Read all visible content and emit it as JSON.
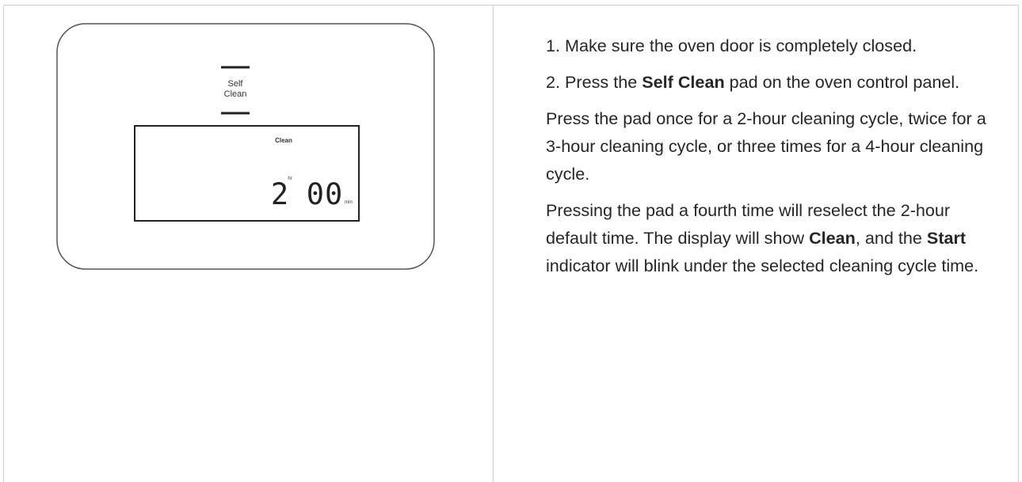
{
  "figure": {
    "pad_label_line1": "Self",
    "pad_label_line2": "Clean",
    "display_mode": "Clean",
    "hours_digit": "2",
    "hours_unit": "hr",
    "minutes_digits": "00",
    "minutes_unit": "min"
  },
  "steps": {
    "step1": "1. Make sure the oven door is completely closed.",
    "step2_prefix": "2. Press the ",
    "step2_bold": "Self Clean",
    "step2_suffix": " pad on the oven control panel.",
    "para3": "Press the pad once for a 2-hour cleaning cycle, twice for a 3-hour cleaning cycle, or three times for a 4-hour cleaning cycle.",
    "para4_prefix": "Pressing the pad a fourth time will reselect the 2-hour default time. The display will show ",
    "para4_bold1": "Clean",
    "para4_mid": ", and the ",
    "para4_bold2": "Start",
    "para4_suffix": " indicator will blink under the selected cleaning cycle time."
  }
}
